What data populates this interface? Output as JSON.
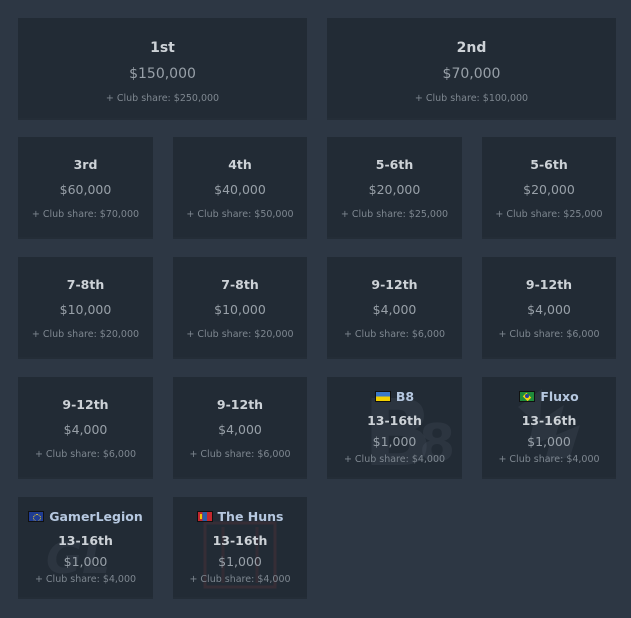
{
  "cards": [
    {
      "place": "1st",
      "amount": "$150,000",
      "share": "+ Club share: $250,000"
    },
    {
      "place": "2nd",
      "amount": "$70,000",
      "share": "+ Club share: $100,000"
    },
    {
      "place": "3rd",
      "amount": "$60,000",
      "share": "+ Club share: $70,000"
    },
    {
      "place": "4th",
      "amount": "$40,000",
      "share": "+ Club share: $50,000"
    },
    {
      "place": "5-6th",
      "amount": "$20,000",
      "share": "+ Club share: $25,000"
    },
    {
      "place": "5-6th",
      "amount": "$20,000",
      "share": "+ Club share: $25,000"
    },
    {
      "place": "7-8th",
      "amount": "$10,000",
      "share": "+ Club share: $20,000"
    },
    {
      "place": "7-8th",
      "amount": "$10,000",
      "share": "+ Club share: $20,000"
    },
    {
      "place": "9-12th",
      "amount": "$4,000",
      "share": "+ Club share: $6,000"
    },
    {
      "place": "9-12th",
      "amount": "$4,000",
      "share": "+ Club share: $6,000"
    },
    {
      "place": "9-12th",
      "amount": "$4,000",
      "share": "+ Club share: $6,000"
    },
    {
      "place": "9-12th",
      "amount": "$4,000",
      "share": "+ Club share: $6,000"
    },
    {
      "team": "B8",
      "flag": "ukraine-flag-icon",
      "place": "13-16th",
      "amount": "$1,000",
      "share": "+ Club share: $4,000"
    },
    {
      "team": "Fluxo",
      "flag": "brazil-flag-icon",
      "place": "13-16th",
      "amount": "$1,000",
      "share": "+ Club share: $4,000"
    },
    {
      "team": "GamerLegion",
      "flag": "europe-flag-icon",
      "place": "13-16th",
      "amount": "$1,000",
      "share": "+ Club share: $4,000"
    },
    {
      "team": "The Huns",
      "flag": "mongolia-flag-icon",
      "place": "13-16th",
      "amount": "$1,000",
      "share": "+ Club share: $4,000"
    }
  ],
  "colors": {
    "background": "#2d3744",
    "card": "#222b35",
    "team_name": "#b6c8e0"
  }
}
